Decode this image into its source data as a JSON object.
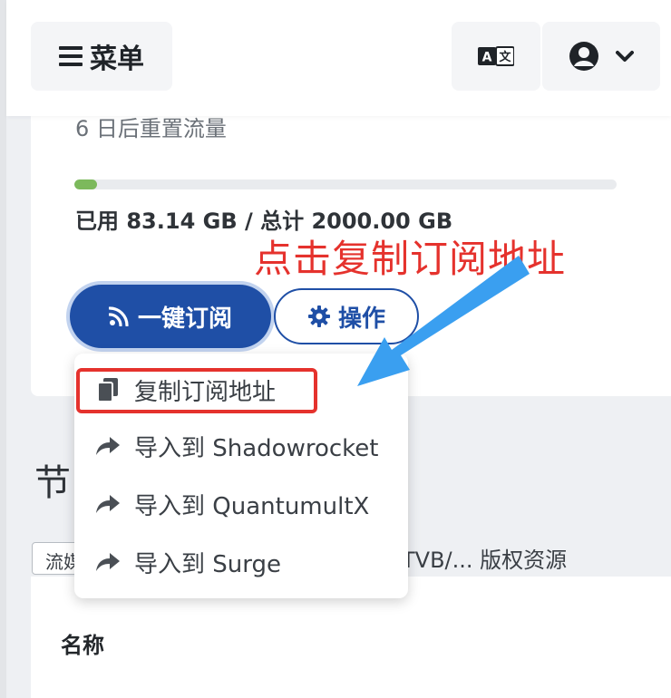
{
  "header": {
    "menu_label": "菜单",
    "lang_icon": "translate-icon",
    "user_icon": "user-circle-icon",
    "dropdown_icon": "chevron-down-icon"
  },
  "card": {
    "reset_text": "6 日后重置流量",
    "usage_text": "已用 83.14 GB / 总计 2000.00 GB",
    "progress": {
      "used": 83.14,
      "total": 2000.0,
      "fill_color": "#7cb95c"
    },
    "subscribe_button": "一键订阅",
    "subscribe_icon": "rss-icon",
    "operations_button": "操作",
    "operations_icon": "gear-icon",
    "accent_color": "#1f4fa6"
  },
  "annotation": {
    "text": "点击复制订阅地址",
    "color": "#e5322d",
    "arrow_color": "#3a9ff0"
  },
  "dropdown": {
    "items": [
      {
        "label": "复制订阅地址",
        "icon": "copy-icon"
      },
      {
        "label": "导入到 Shadowrocket",
        "icon": "share-icon"
      },
      {
        "label": "导入到 QuantumultX",
        "icon": "share-icon"
      },
      {
        "label": "导入到 Surge",
        "icon": "share-icon"
      }
    ]
  },
  "nodes": {
    "title_partial": "节",
    "tag_partial": "流媒",
    "tvb_text": "TVB/... 版权资源",
    "table_header_name": "名称"
  }
}
